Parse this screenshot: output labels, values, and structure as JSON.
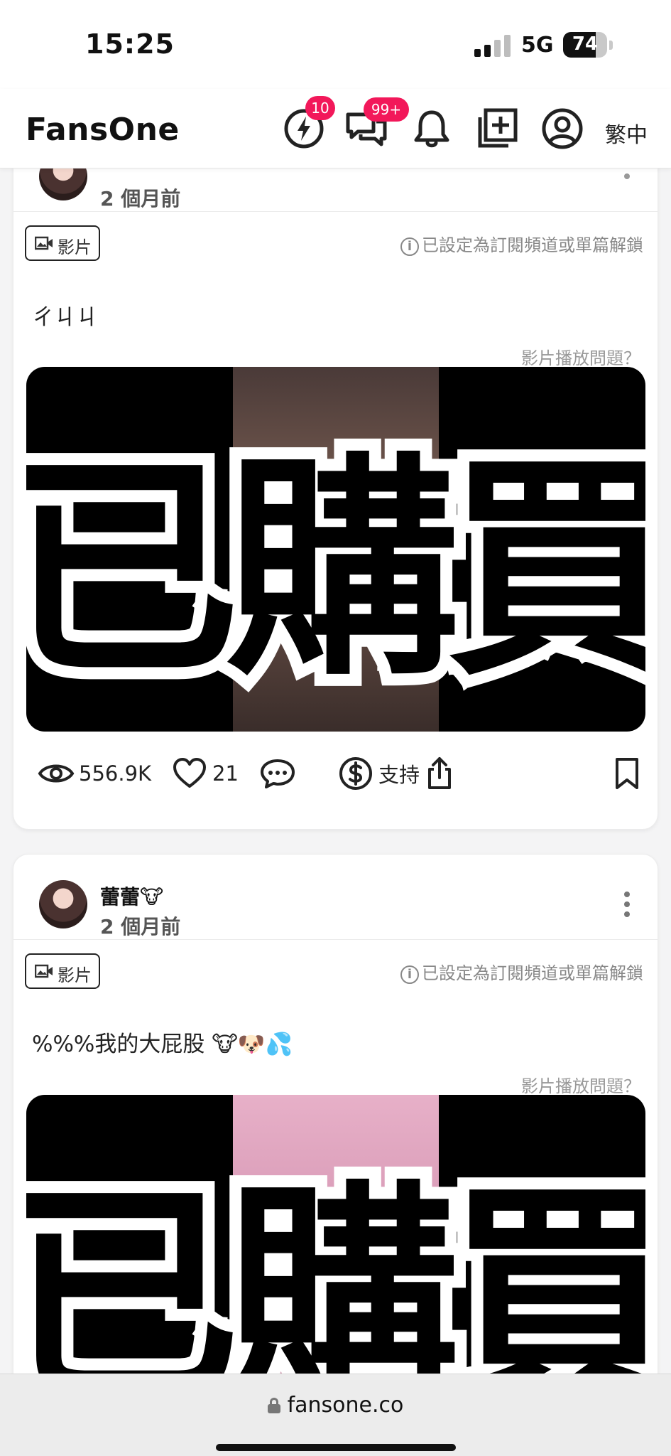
{
  "status_bar": {
    "time": "15:25",
    "network": "5G",
    "battery": "74",
    "battery_level": 0.74,
    "signal_bars": 2
  },
  "header": {
    "brand": "FansOne",
    "notifications": {
      "flash_badge": "10",
      "messages_badge": "99+"
    },
    "language": "繁中"
  },
  "posts": [
    {
      "author": "",
      "time": "2 個月前",
      "type_label": "影片",
      "unlock_note": "已設定為訂閱頻道或單篇解鎖",
      "text": "ㄔㄐㄐ",
      "video_issue": "影片播放問題？",
      "watermark_text": "已購買",
      "stats": {
        "views": "556.9K",
        "likes": "21",
        "support": "支持"
      }
    },
    {
      "author": "蕾蕾🐮",
      "time": "2 個月前",
      "type_label": "影片",
      "unlock_note": "已設定為訂閱頻道或單篇解鎖",
      "text": "%%%我的大屁股 🐮🐶💦",
      "video_issue": "影片播放問題？",
      "watermark_text": "已購買"
    }
  ],
  "url_bar": {
    "domain": "fansone.co"
  },
  "colors": {
    "badge": "#f2185a",
    "background": "#f4f4f5",
    "card": "#ffffff"
  },
  "icons": [
    "flash-icon",
    "message-icon",
    "bell-icon",
    "add-post-icon",
    "profile-icon",
    "video-icon",
    "info-icon",
    "eye-icon",
    "heart-icon",
    "comment-icon",
    "dollar-icon",
    "share-icon",
    "bookmark-icon",
    "more-icon",
    "lock-icon"
  ]
}
